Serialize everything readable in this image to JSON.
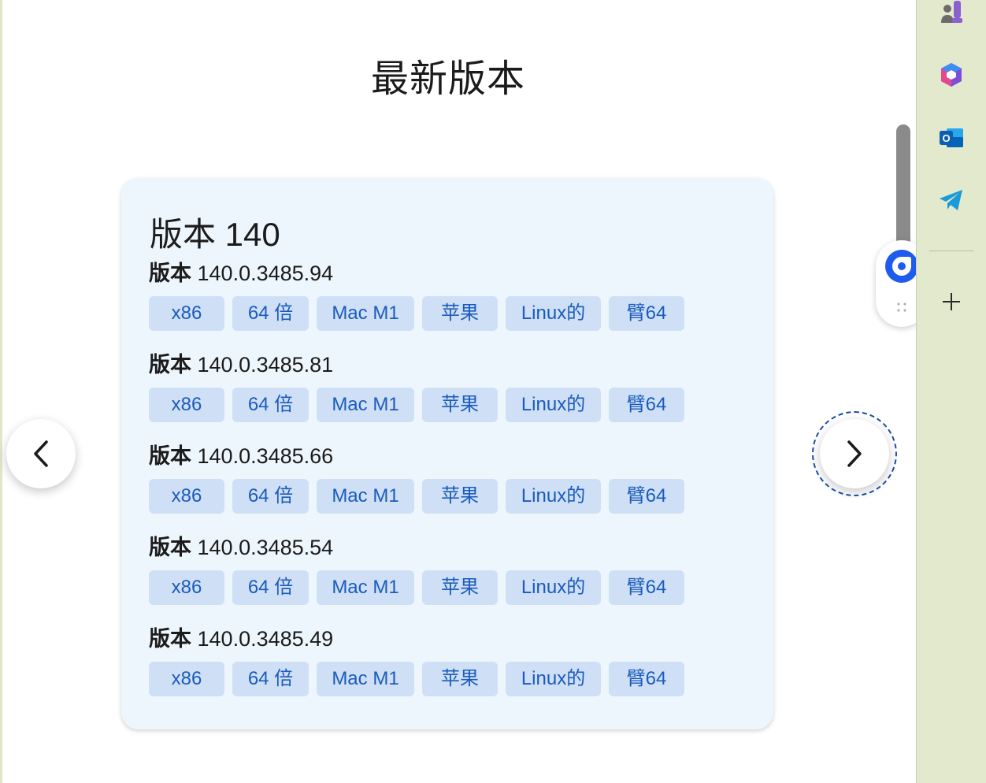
{
  "page": {
    "title": "最新版本"
  },
  "card": {
    "title": "版本 140",
    "versions": [
      {
        "prefix": "版本",
        "number": "140.0.3485.94",
        "tags": [
          "x86",
          "64 倍",
          "Mac M1",
          "苹果",
          "Linux的",
          "臂64"
        ]
      },
      {
        "prefix": "版本",
        "number": "140.0.3485.81",
        "tags": [
          "x86",
          "64 倍",
          "Mac M1",
          "苹果",
          "Linux的",
          "臂64"
        ]
      },
      {
        "prefix": "版本",
        "number": "140.0.3485.66",
        "tags": [
          "x86",
          "64 倍",
          "Mac M1",
          "苹果",
          "Linux的",
          "臂64"
        ]
      },
      {
        "prefix": "版本",
        "number": "140.0.3485.54",
        "tags": [
          "x86",
          "64 倍",
          "Mac M1",
          "苹果",
          "Linux的",
          "臂64"
        ]
      },
      {
        "prefix": "版本",
        "number": "140.0.3485.49",
        "tags": [
          "x86",
          "64 倍",
          "Mac M1",
          "苹果",
          "Linux的",
          "臂64"
        ]
      }
    ]
  },
  "navigation": {
    "prev_icon": "chevron-left-icon",
    "next_icon": "chevron-right-icon"
  },
  "sidebar": {
    "icons": [
      "games-icon",
      "microsoft365-icon",
      "outlook-icon",
      "telegram-icon",
      "add-icon"
    ]
  },
  "floating": {
    "icon": "copilot-icon"
  },
  "colors": {
    "card_bg": "#eef6fd",
    "tag_bg": "#cfe0f6",
    "tag_text": "#1a5bbd",
    "sidebar_bg": "#e2e9cc",
    "accent": "#1e5cf0"
  }
}
